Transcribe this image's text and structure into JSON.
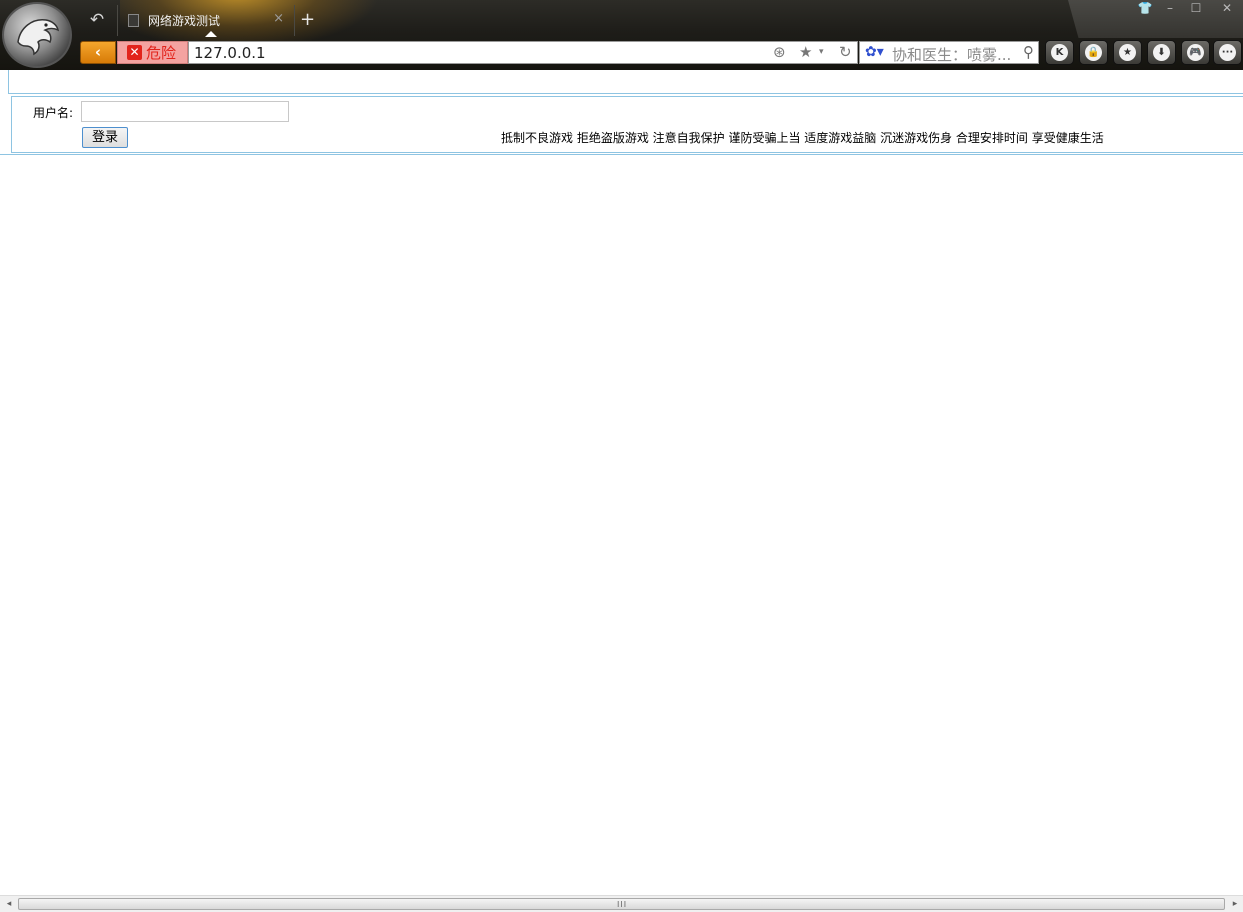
{
  "browser": {
    "tab": {
      "title": "网络游戏测试",
      "close": "×"
    },
    "new_tab": "+",
    "back_glyph": "‹",
    "danger_mark": "✕",
    "danger_label": "危险",
    "address": "127.0.0.1",
    "search_placeholder": "协和医生：喷雾...",
    "toolbar_buttons": [
      "K",
      "🔒",
      "★",
      "⬇",
      "🎮",
      "···"
    ],
    "window_controls": [
      "👕",
      "–",
      "☐",
      "✕"
    ]
  },
  "form": {
    "username_label": "用户名:",
    "username_value": "",
    "login_button": "登录"
  },
  "slogan": "抵制不良游戏 拒绝盗版游戏 注意自我保护 谨防受骗上当 适度游戏益脑 沉迷游戏伤身 合理安排时间 享受健康生活",
  "scrollbar": {
    "left": "◂",
    "right": "▸",
    "grip": "III"
  }
}
